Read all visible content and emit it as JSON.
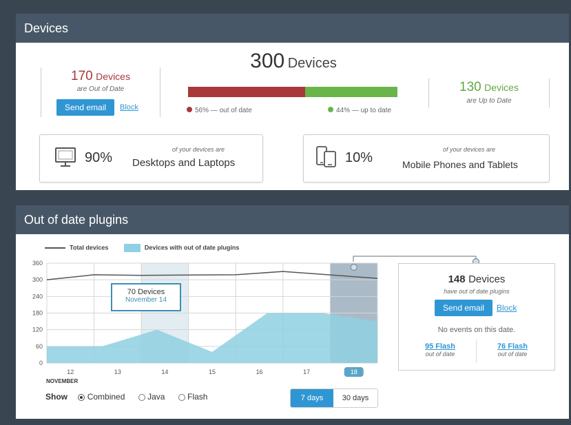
{
  "devices_panel": {
    "title": "Devices",
    "out_of_date": {
      "count": "170",
      "unit": "Devices",
      "subtitle": "are Out of Date",
      "send_email": "Send email",
      "block": "Block"
    },
    "total": {
      "count": "300",
      "unit": "Devices"
    },
    "bar": {
      "out_of_date_fraction": 0.56,
      "out_of_date_label": "56% — out of date",
      "up_to_date_label": "44% — up to date",
      "out_of_date_color": "#a8383a",
      "up_to_date_color": "#6ab54a"
    },
    "up_to_date": {
      "count": "130",
      "unit": "Devices",
      "subtitle": "are Up to Date"
    },
    "desktops": {
      "icon": "monitor-icon",
      "percent": "90%",
      "caption": "of your devices are",
      "label": "Desktops and Laptops"
    },
    "mobile": {
      "icon": "phone-tablet-icon",
      "percent": "10%",
      "caption": "of your devices are",
      "label": "Mobile Phones and Tablets"
    }
  },
  "plugins_panel": {
    "title": "Out of date plugins",
    "legend_total": "Total devices",
    "legend_outdated": "Devices with out of date plugins",
    "month_label": "NOVEMBER",
    "tooltip": {
      "title": "70 Devices",
      "date": "November 14"
    },
    "show_label": "Show",
    "filters": [
      "Combined",
      "Java",
      "Flash"
    ],
    "selected_filter": "Combined",
    "ranges": [
      "7 days",
      "30 days"
    ],
    "selected_range": "7 days",
    "side_card": {
      "count": "148",
      "unit": "Devices",
      "subtitle": "have out of date plugins",
      "send_email": "Send email",
      "block": "Block",
      "no_events": "No events on this date.",
      "flash_left": "95 Flash",
      "flash_left_sub": "out of date",
      "flash_right": "76 Flash",
      "flash_right_sub": "out of date"
    }
  },
  "chart_data": {
    "type": "area",
    "x": [
      "12",
      "13",
      "14",
      "15",
      "16",
      "17",
      "18"
    ],
    "ylim": [
      0,
      360
    ],
    "yticks": [
      0,
      60,
      120,
      180,
      240,
      300,
      360
    ],
    "highlighted_categories": [
      "14",
      "18"
    ],
    "selected_category": "18",
    "series": [
      {
        "name": "Total devices",
        "kind": "line",
        "color": "#555555",
        "values": [
          300,
          318,
          316,
          318,
          330,
          305
        ]
      },
      {
        "name": "Devices with out of date plugins",
        "kind": "area",
        "color": "#8fd0e2",
        "values": [
          60,
          60,
          120,
          40,
          180,
          180,
          150
        ]
      }
    ],
    "total_line_x": [
      "12",
      "13",
      "14",
      "16",
      "17",
      "18"
    ]
  }
}
